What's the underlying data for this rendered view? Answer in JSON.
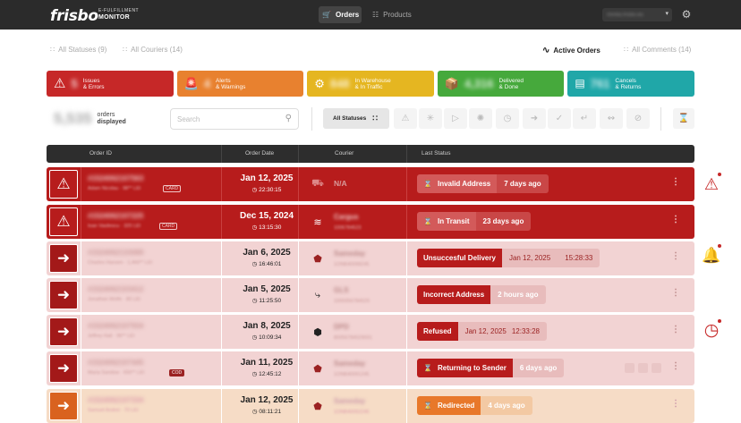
{
  "header": {
    "logo": "frisbo",
    "logo_sub_top": "E-FULFILLMENT",
    "logo_sub": "MONITOR",
    "nav_orders": "Orders",
    "nav_products": "Products",
    "user": "mirela.frisbo.eu"
  },
  "filters": {
    "all_statuses": "All Statuses (9)",
    "all_couriers": "All Couriers (14)",
    "active_orders": "Active Orders",
    "all_comments": "All Comments (14)"
  },
  "cards": [
    {
      "num": "5",
      "line1": "Issues",
      "line2": "& Errors",
      "color": "#c62828"
    },
    {
      "num": "4",
      "line1": "Alerts",
      "line2": "& Warnings",
      "color": "#e8812f"
    },
    {
      "num": "848",
      "line1": "In Warehouse",
      "line2": "& In Traffic",
      "color": "#e5b621"
    },
    {
      "num": "4,316",
      "line1": "Delivered",
      "line2": "& Done",
      "color": "#46a93c"
    },
    {
      "num": "761",
      "line1": "Cancels",
      "line2": "& Returns",
      "color": "#20a7a8"
    }
  ],
  "kpi": {
    "count": "5,535",
    "line1": "orders",
    "line2": "displayed"
  },
  "search": {
    "placeholder": "Search"
  },
  "status_filter": {
    "all_label": "All Statuses"
  },
  "table": {
    "col_order_id": "Order ID",
    "col_order_date": "Order Date",
    "col_courier": "Courier",
    "col_last_status": "Last Status"
  },
  "rows": [
    {
      "order_id": "#1524062107563",
      "customer": "Adam Nicolau · 98** LEI",
      "tag": "CARD",
      "date": "Jan 12, 2025",
      "time": "22:30:15",
      "courier": "",
      "courier_na": "N/A",
      "tracking": "",
      "status": "Invalid Address",
      "since": "7 days ago",
      "extra": ""
    },
    {
      "order_id": "#1524062107225",
      "customer": "Ioan Vasilescu · 320 LEI",
      "tag": "CARD",
      "date": "Dec 15, 2024",
      "time": "13:15:30",
      "courier": "Cargus",
      "courier_na": "",
      "tracking": "1006784523",
      "status": "In Transit",
      "since": "23 days ago",
      "extra": ""
    },
    {
      "order_id": "#1524062133089",
      "customer": "Charles Hansen · 1,460** LEI",
      "tag": "",
      "date": "Jan 6, 2025",
      "time": "16:46:01",
      "courier": "Sameday",
      "courier_na": "",
      "tracking": "1ONB40098245",
      "status": "Unsuccesful Delivery",
      "since": "Jan 12, 2025",
      "extra": "15:28:33"
    },
    {
      "order_id": "#1524062103412",
      "customer": "Jonathan Wolfe · 80 LEI",
      "tag": "",
      "date": "Jan 5, 2025",
      "time": "11:25:50",
      "courier": "GLS",
      "courier_na": "",
      "tracking": "1000056784529",
      "status": "Incorrect Address",
      "since": "2 hours ago",
      "extra": ""
    },
    {
      "order_id": "#1524062107934",
      "customer": "Jeffrey Hall · 96** LEI",
      "tag": "",
      "date": "Jan 8, 2025",
      "time": "10:09:34",
      "courier": "DPD",
      "courier_na": "",
      "tracking": "80056784529001",
      "status": "Refused",
      "since": "Jan 12, 2025",
      "extra": "12:33:28"
    },
    {
      "order_id": "#1524062107445",
      "customer": "Maria Sandow · 650** LEI",
      "tag": "COD",
      "date": "Jan 11, 2025",
      "time": "12:45:12",
      "courier": "Sameday",
      "courier_na": "",
      "tracking": "1ONB40091245",
      "status": "Returning to Sender",
      "since": "6 days ago",
      "extra": ""
    },
    {
      "order_id": "#1524062107334",
      "customer": "Samuel Andrei · 70 LEI",
      "tag": "",
      "date": "Jan 12, 2025",
      "time": "08:11:21",
      "courier": "Sameday",
      "courier_na": "",
      "tracking": "1ONB40092245",
      "status": "Redirected",
      "since": "4 days ago",
      "extra": ""
    }
  ]
}
